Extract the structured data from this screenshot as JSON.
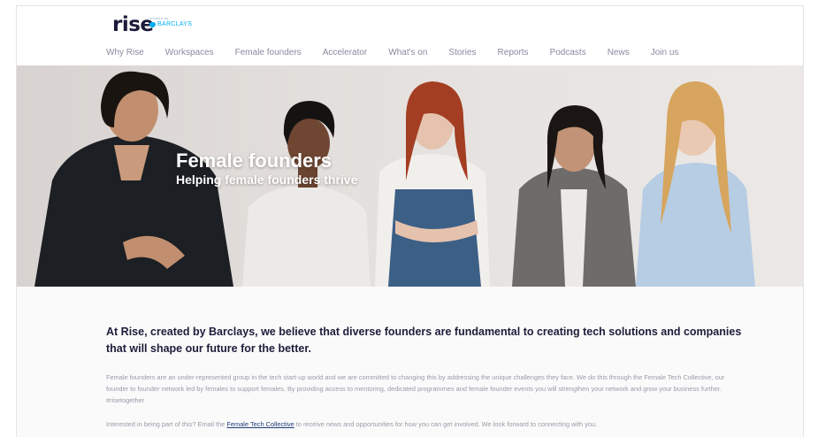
{
  "brand": {
    "logo_text": "rise",
    "created_by": "created by",
    "partner": "BARCLAYS",
    "partner_color": "#00aeef"
  },
  "nav": {
    "items": [
      "Why Rise",
      "Workspaces",
      "Female founders",
      "Accelerator",
      "What's on",
      "Stories",
      "Reports",
      "Podcasts",
      "News",
      "Join us"
    ]
  },
  "hero": {
    "title": "Female founders",
    "subtitle": "Helping female founders thrive",
    "image": "group-of-five-women-photo"
  },
  "content": {
    "intro": "At Rise, created by Barclays, we believe that diverse founders are fundamental to creating tech solutions and companies that will shape our future for the better.",
    "paragraph": "Female founders are an under-represented group in the tech start-up world and we are committed to changing this by addressing the unique challenges they face. We do this through the Female Tech Collective, our founder to founder network led by females to support females. By providing access to mentoring, dedicated programmes and female founder events you will strengthen your network and grow your business further. #risetogether",
    "cta_before": "Interested in being part of this? Email the ",
    "cta_link": "Female Tech Collective",
    "cta_after": " to receive news and opportunities for how you can get involved. We look forward to connecting with you."
  },
  "colors": {
    "text_dark": "#1d1d3b",
    "text_muted": "#9a9aab",
    "link": "#1f3d7a"
  }
}
